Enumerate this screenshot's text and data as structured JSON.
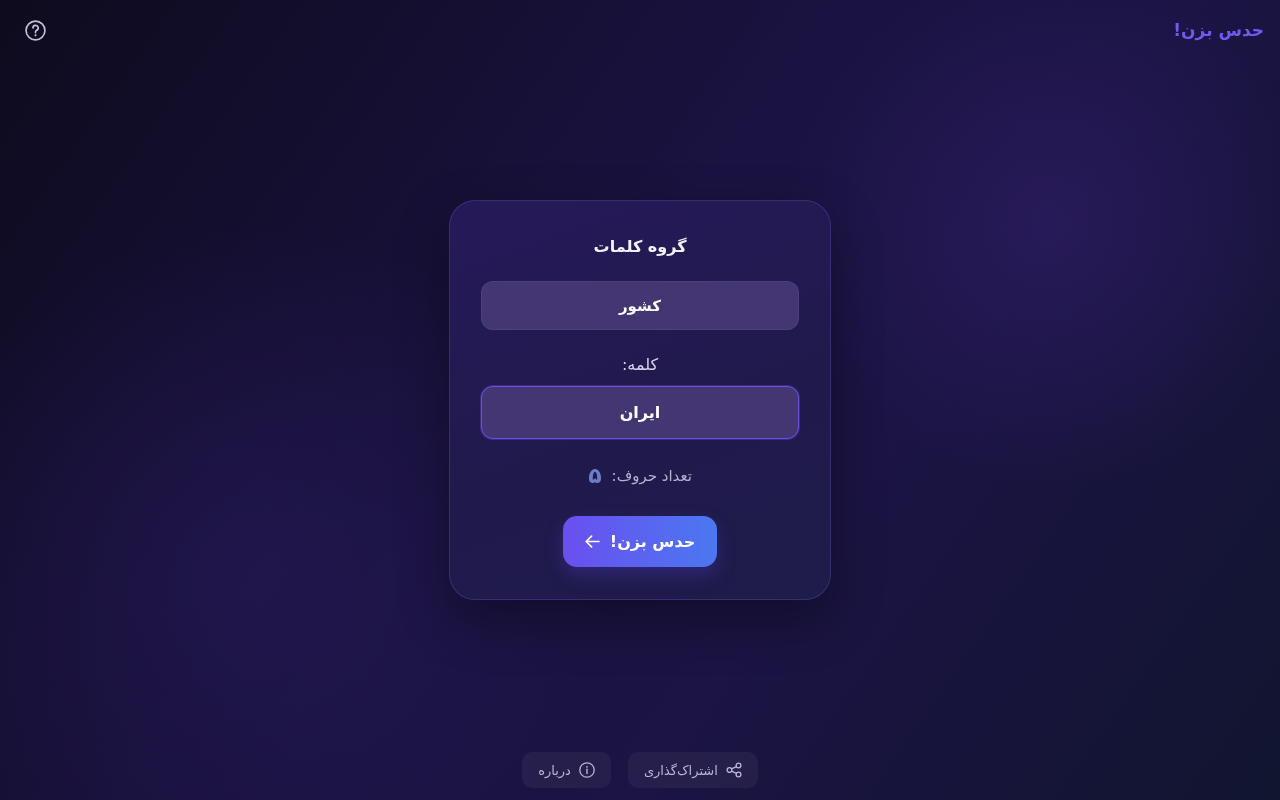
{
  "header": {
    "logo": "حدس بزن!"
  },
  "card": {
    "title": "گروه کلمات",
    "category": {
      "value": "کشور"
    },
    "word_label": "کلمه:",
    "word_field": {
      "value": "ایران",
      "focused": true
    },
    "letter_count": {
      "label": "تعداد حروف:",
      "value": "۵"
    },
    "submit_button": {
      "label": "حدس بزن!"
    }
  },
  "footer": {
    "buttons": [
      {
        "kind": "share",
        "label": "اشتراک‌گذاری"
      },
      {
        "kind": "about",
        "label": "درباره"
      }
    ]
  }
}
